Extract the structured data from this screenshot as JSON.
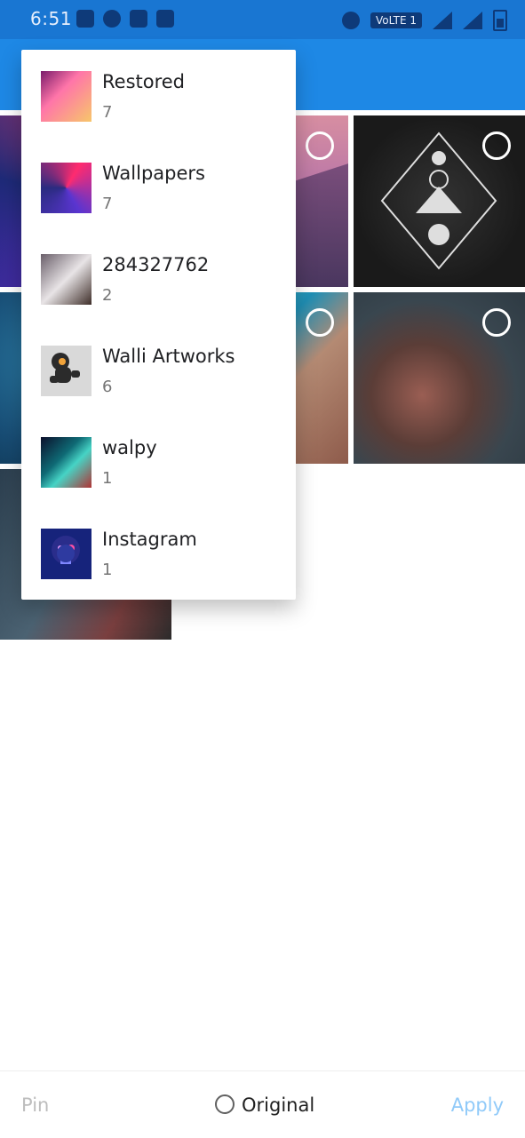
{
  "status_bar": {
    "time": "6:51",
    "network_badge": "VoLTE 1",
    "icons": [
      "notes-icon",
      "phone-icon",
      "image-icon",
      "image-icon",
      "hotspot-icon",
      "signal-icon",
      "signal-icon",
      "battery-icon"
    ]
  },
  "colors": {
    "status_bar": "#1976d2",
    "app_bar": "#1e88e5",
    "accent": "#90caf9",
    "text_primary": "#202124",
    "text_secondary": "#757575"
  },
  "album_menu": {
    "items": [
      {
        "name": "Restored",
        "count": "7"
      },
      {
        "name": "Wallpapers",
        "count": "7"
      },
      {
        "name": "284327762",
        "count": "2"
      },
      {
        "name": "Walli Artworks",
        "count": "6"
      },
      {
        "name": "walpy",
        "count": "1"
      },
      {
        "name": "Instagram",
        "count": "1"
      }
    ]
  },
  "bottom_bar": {
    "pin_label": "Pin",
    "original_label": "Original",
    "apply_label": "Apply"
  }
}
